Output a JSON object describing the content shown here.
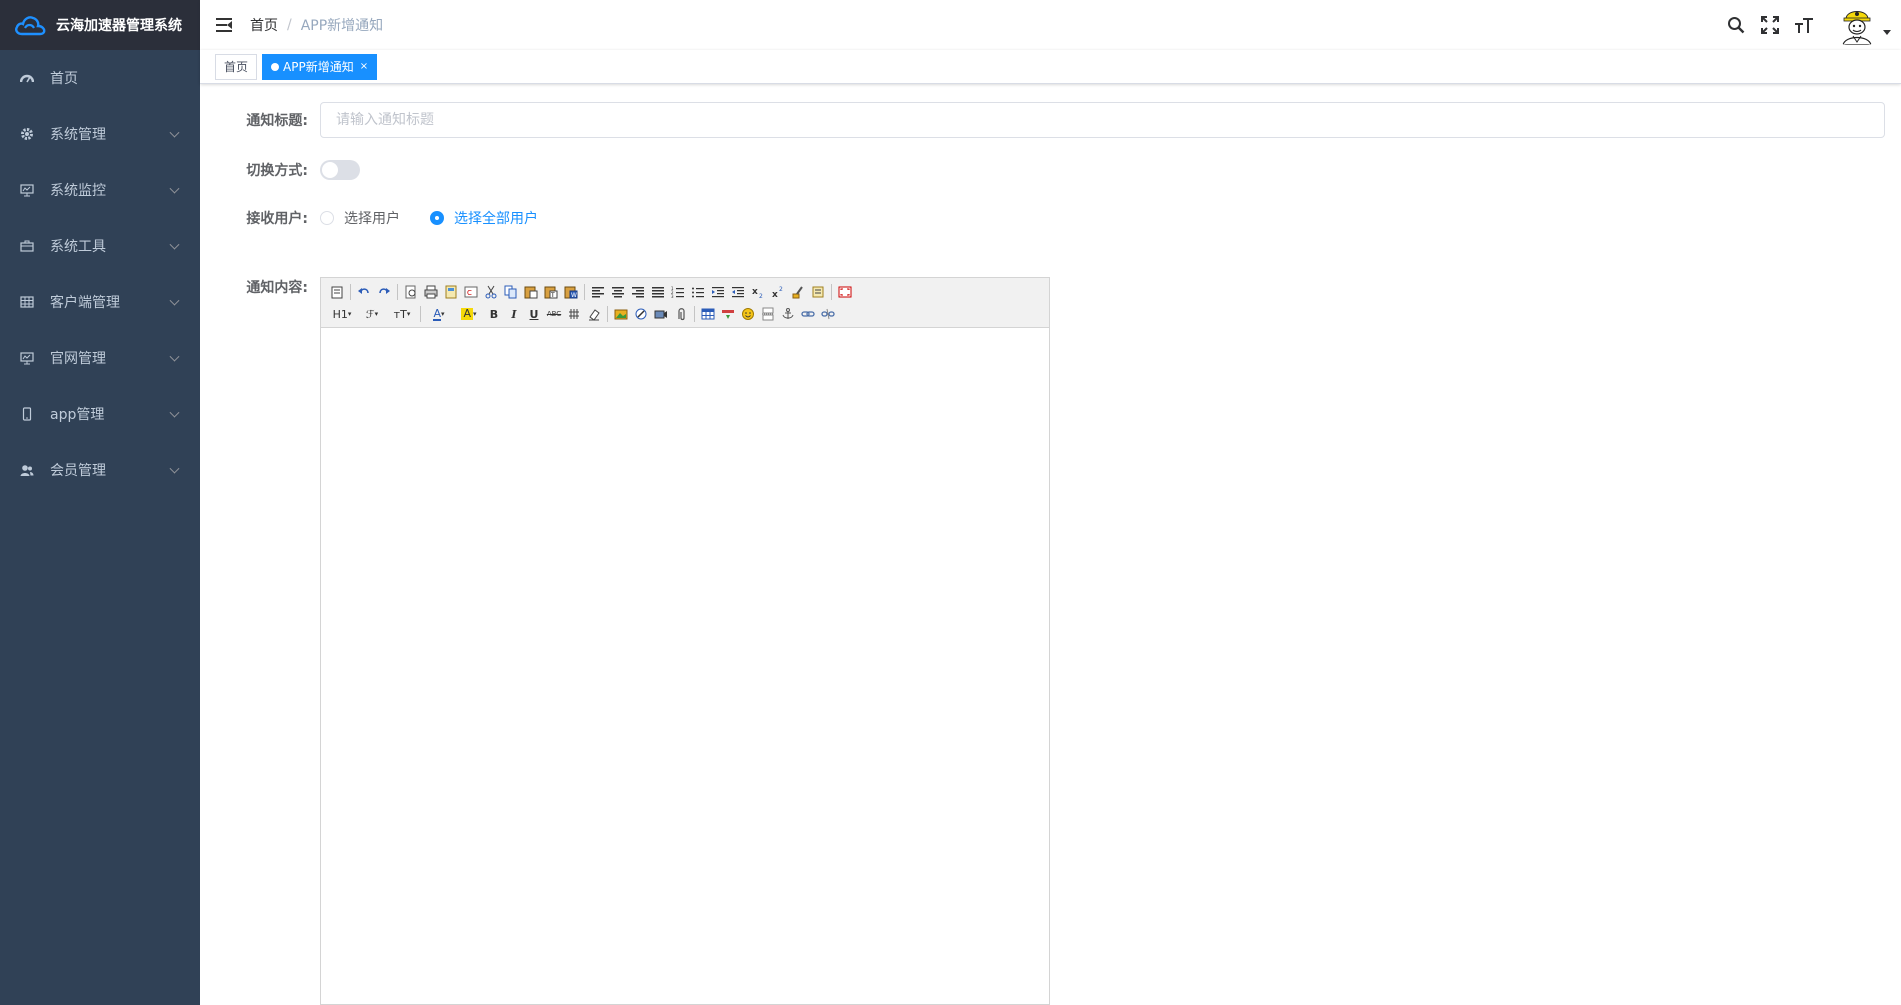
{
  "app": {
    "title": "云海加速器管理系统"
  },
  "sidebar": {
    "items": [
      {
        "label": "首页",
        "icon": "dashboard-icon",
        "expandable": false
      },
      {
        "label": "系统管理",
        "icon": "gear-icon",
        "expandable": true
      },
      {
        "label": "系统监控",
        "icon": "monitor-icon",
        "expandable": true
      },
      {
        "label": "系统工具",
        "icon": "toolbox-icon",
        "expandable": true
      },
      {
        "label": "客户端管理",
        "icon": "table-icon",
        "expandable": true
      },
      {
        "label": "官网管理",
        "icon": "monitor-icon",
        "expandable": true
      },
      {
        "label": "app管理",
        "icon": "phone-icon",
        "expandable": true
      },
      {
        "label": "会员管理",
        "icon": "users-icon",
        "expandable": true
      }
    ]
  },
  "navbar": {
    "breadcrumb": {
      "home": "首页",
      "separator": "/",
      "current": "APP新增通知"
    }
  },
  "tags": {
    "home": "首页",
    "active": "APP新增通知",
    "close": "×"
  },
  "form": {
    "title_label": "通知标题:",
    "title_placeholder": "请输入通知标题",
    "title_value": "",
    "switch_label": "切换方式:",
    "switch_on": false,
    "users_label": "接收用户:",
    "radio_select_users": "选择用户",
    "radio_all_users": "选择全部用户",
    "selected_radio": "all",
    "content_label": "通知内容:"
  },
  "editor": {
    "row2_labels": {
      "heading": "H1",
      "font_family": "ℱ",
      "font_size": "тT",
      "font_color": "A",
      "back_color": "A",
      "bold": "B",
      "italic": "I",
      "underline": "U",
      "strike": "ABC"
    }
  },
  "colors": {
    "sidebar_bg": "#304156",
    "logo_bg": "#2b2f3a",
    "accent": "#1890ff"
  }
}
